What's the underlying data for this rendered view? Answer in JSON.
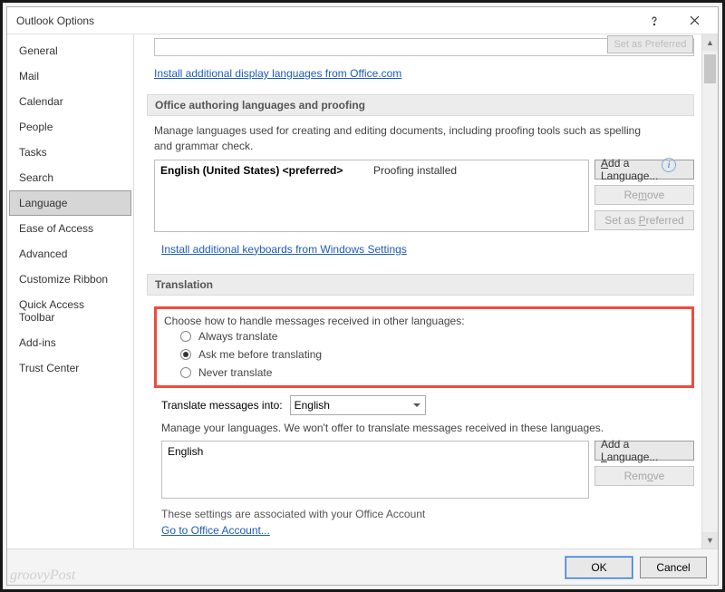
{
  "watermark": "groovyPost",
  "dialog": {
    "title": "Outlook Options",
    "close_label": "Close",
    "help_label": "Help"
  },
  "sidebar": {
    "items": [
      {
        "label": "General"
      },
      {
        "label": "Mail"
      },
      {
        "label": "Calendar"
      },
      {
        "label": "People"
      },
      {
        "label": "Tasks"
      },
      {
        "label": "Search"
      },
      {
        "label": "Language",
        "selected": true
      },
      {
        "label": "Ease of Access"
      },
      {
        "label": "Advanced"
      },
      {
        "label": "Customize Ribbon"
      },
      {
        "label": "Quick Access Toolbar"
      },
      {
        "label": "Add-ins"
      },
      {
        "label": "Trust Center"
      }
    ]
  },
  "links": {
    "display_lang": "Install additional display languages from Office.com",
    "keyboards": "Install additional keyboards from Windows Settings",
    "office_account": "Go to Office Account..."
  },
  "sections": {
    "authoring": {
      "heading": "Office authoring languages and proofing",
      "desc": "Manage languages used for creating and editing documents, including proofing tools such as spelling and grammar check.",
      "list": [
        {
          "lang": "English (United States) <preferred>",
          "status": "Proofing installed"
        }
      ],
      "buttons": {
        "add": "Add a Language...",
        "remove": "Remove",
        "set_preferred": "Set as Preferred"
      }
    },
    "translation": {
      "heading": "Translation",
      "choose_label": "Choose how to handle messages received in other languages:",
      "options": {
        "always": "Always translate",
        "ask": "Ask me before translating",
        "never": "Never translate"
      },
      "selected_option": "ask",
      "translate_into_label": "Translate messages into:",
      "translate_into_value": "English",
      "manage_label": "Manage your languages. We won't offer to translate messages received in these languages.",
      "languages": [
        "English"
      ],
      "buttons": {
        "add": "Add a Language...",
        "remove": "Remove"
      },
      "footer": "These settings are associated with your Office Account"
    }
  },
  "footer": {
    "ok": "OK",
    "cancel": "Cancel"
  }
}
